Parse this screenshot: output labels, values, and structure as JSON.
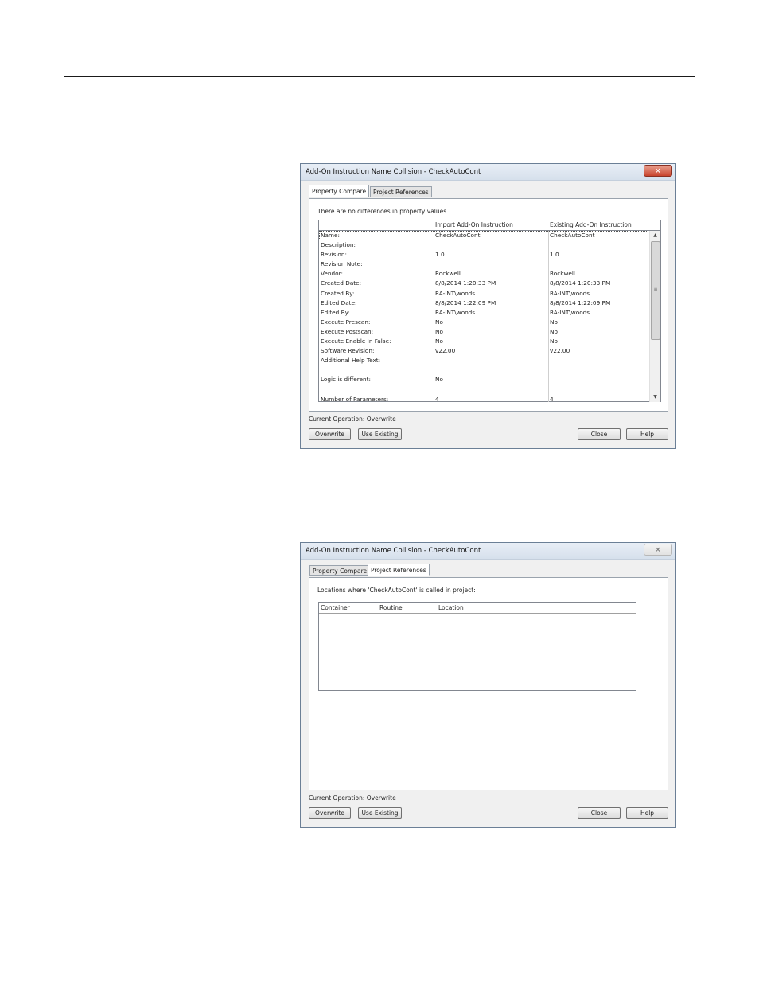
{
  "dialog1": {
    "title": "Add-On Instruction Name Collision - CheckAutoCont",
    "close_glyph": "✕",
    "tabs": [
      "Property Compare",
      "Project References"
    ],
    "message": "There are no differences in property values.",
    "columns": [
      "",
      "Import Add-On Instruction",
      "Existing Add-On Instruction"
    ],
    "rows": [
      [
        "Name:",
        "CheckAutoCont",
        "CheckAutoCont"
      ],
      [
        "Description:",
        "",
        ""
      ],
      [
        "Revision:",
        "1.0",
        "1.0"
      ],
      [
        "Revision Note:",
        "",
        ""
      ],
      [
        "Vendor:",
        "Rockwell",
        "Rockwell"
      ],
      [
        "Created Date:",
        "8/8/2014  1:20:33 PM",
        "8/8/2014  1:20:33 PM"
      ],
      [
        "Created By:",
        "RA-INT\\woods",
        "RA-INT\\woods"
      ],
      [
        "Edited Date:",
        "8/8/2014  1:22:09 PM",
        "8/8/2014  1:22:09 PM"
      ],
      [
        "Edited By:",
        "RA-INT\\woods",
        "RA-INT\\woods"
      ],
      [
        "Execute Prescan:",
        "No",
        "No"
      ],
      [
        "Execute Postscan:",
        "No",
        "No"
      ],
      [
        "Execute Enable In False:",
        "No",
        "No"
      ],
      [
        "Software Revision:",
        "v22.00",
        "v22.00"
      ],
      [
        "Additional Help Text:",
        "",
        ""
      ],
      [
        "",
        "",
        ""
      ],
      [
        "Logic is different:",
        "No",
        ""
      ],
      [
        "",
        "",
        ""
      ],
      [
        "Number of Parameters:",
        "4",
        "4"
      ]
    ],
    "current_operation": "Current Operation: Overwrite",
    "buttons": {
      "overwrite": "Overwrite",
      "use_existing": "Use Existing",
      "close": "Close",
      "help": "Help"
    }
  },
  "dialog2": {
    "title": "Add-On Instruction Name Collision - CheckAutoCont",
    "close_glyph": "✕",
    "tabs": [
      "Property Compare",
      "Project References"
    ],
    "message": "Locations where 'CheckAutoCont' is called in project:",
    "columns": [
      "Container",
      "Routine",
      "Location"
    ],
    "current_operation": "Current Operation: Overwrite",
    "buttons": {
      "overwrite": "Overwrite",
      "use_existing": "Use Existing",
      "close": "Close",
      "help": "Help"
    }
  }
}
